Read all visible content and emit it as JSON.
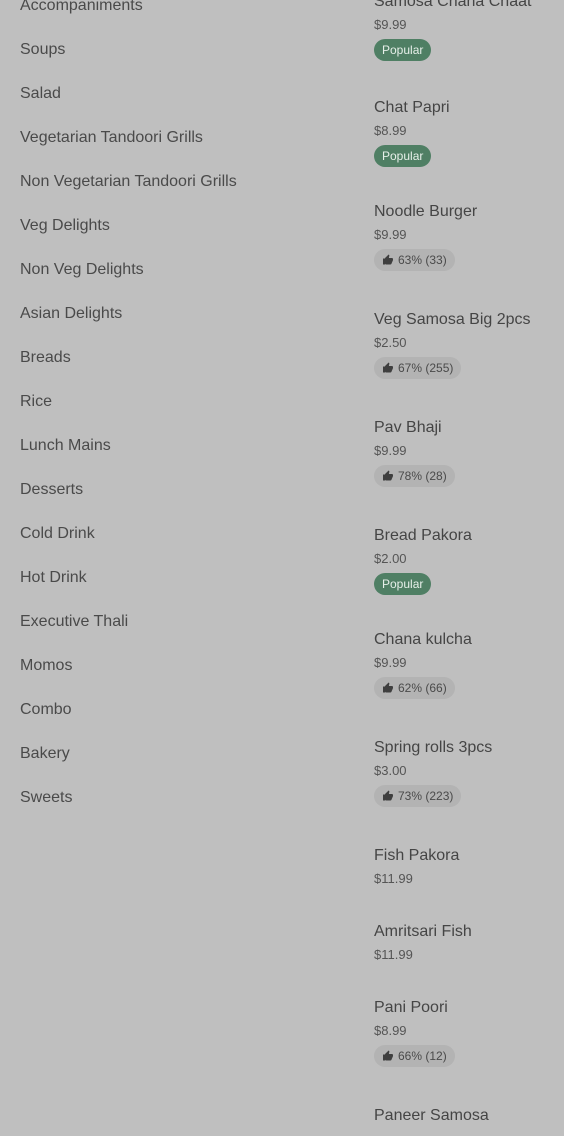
{
  "categories": [
    "Accompaniments",
    "Soups",
    "Salad",
    "Vegetarian Tandoori Grills",
    "Non Vegetarian Tandoori Grills",
    "Veg Delights",
    "Non Veg Delights",
    "Asian Delights",
    "Breads",
    "Rice",
    "Lunch Mains",
    "Desserts",
    "Cold Drink",
    "Hot Drink",
    "Executive Thali",
    "Momos",
    "Combo",
    "Bakery",
    "Sweets"
  ],
  "menu_items": [
    {
      "name": "Samosa Chana Chaat",
      "price": "$9.99",
      "badge": "Popular"
    },
    {
      "name": "Chat Papri",
      "price": "$8.99",
      "badge": "Popular"
    },
    {
      "name": "Noodle Burger",
      "price": "$9.99",
      "rating": "63% (33)"
    },
    {
      "name": "Veg Samosa Big 2pcs",
      "price": "$2.50",
      "rating": "67% (255)"
    },
    {
      "name": "Pav Bhaji",
      "price": "$9.99",
      "rating": "78% (28)"
    },
    {
      "name": "Bread Pakora",
      "price": "$2.00",
      "badge": "Popular"
    },
    {
      "name": "Chana kulcha",
      "price": "$9.99",
      "rating": "62% (66)"
    },
    {
      "name": "Spring rolls 3pcs",
      "price": "$3.00",
      "rating": "73% (223)"
    },
    {
      "name": "Fish Pakora",
      "price": "$11.99"
    },
    {
      "name": "Amritsari Fish",
      "price": "$11.99"
    },
    {
      "name": "Pani Poori",
      "price": "$8.99",
      "rating": "66% (12)"
    },
    {
      "name": "Paneer Samosa",
      "price": ""
    }
  ],
  "colors": {
    "background": "#bfbfbf",
    "popular_badge": "#4f7f64",
    "rating_badge": "#b3b3b3"
  },
  "icons": {
    "rating": "thumbs-up-icon"
  }
}
